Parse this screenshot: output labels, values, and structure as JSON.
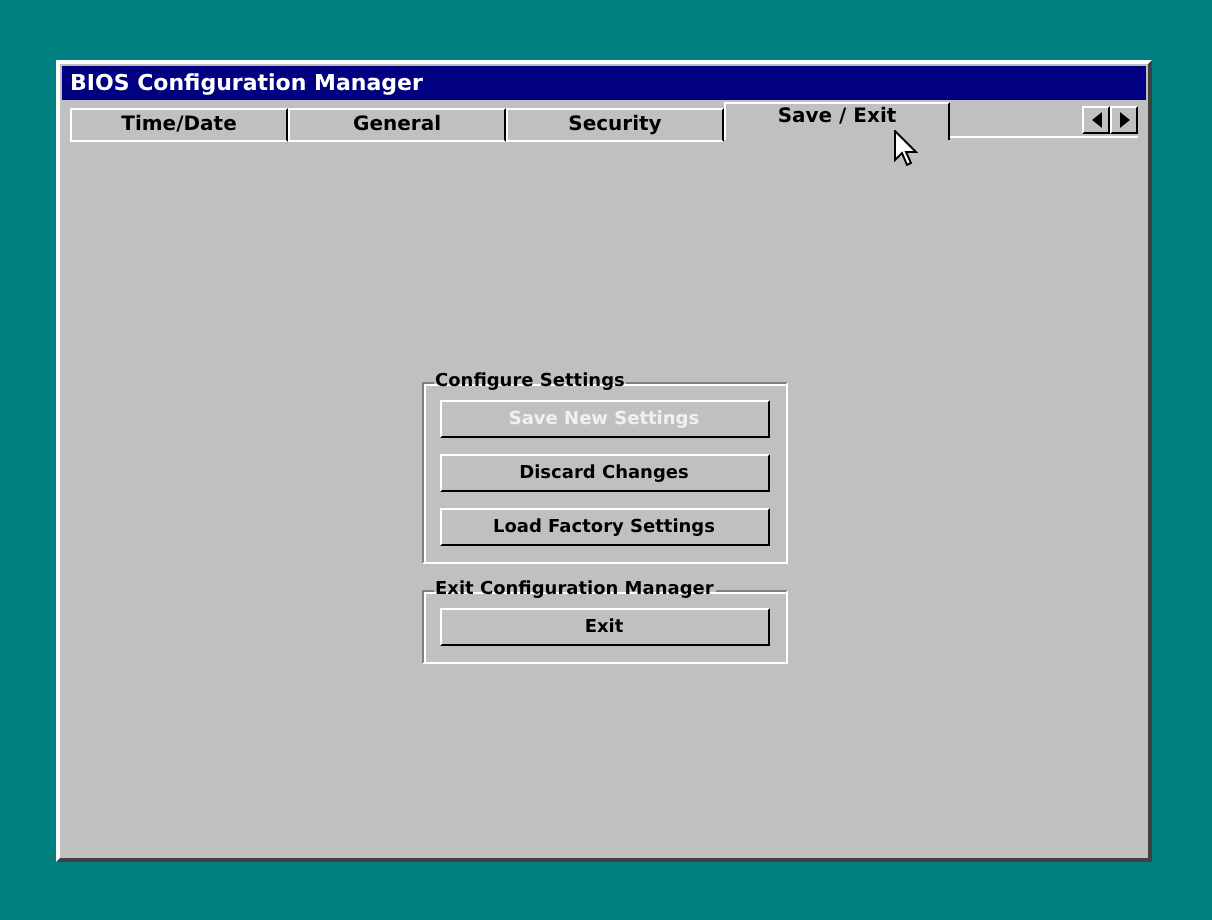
{
  "window": {
    "title": "BIOS Configuration Manager"
  },
  "tabs": [
    {
      "label": "Time/Date",
      "selected": false
    },
    {
      "label": "General",
      "selected": false
    },
    {
      "label": "Security",
      "selected": false
    },
    {
      "label": "Save / Exit",
      "selected": true
    }
  ],
  "groups": [
    {
      "title": "Configure Settings",
      "buttons": [
        {
          "label": "Save New Settings",
          "disabled": true
        },
        {
          "label": "Discard Changes",
          "disabled": false
        },
        {
          "label": "Load Factory Settings",
          "disabled": false
        }
      ]
    },
    {
      "title": "Exit Configuration Manager",
      "buttons": [
        {
          "label": "Exit",
          "disabled": false
        }
      ]
    }
  ]
}
